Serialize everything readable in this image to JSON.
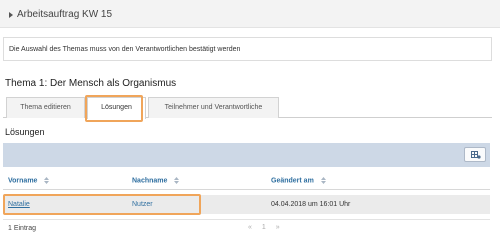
{
  "header": {
    "title": "Arbeitsauftrag KW 15"
  },
  "notice": {
    "text": "Die Auswahl des Themas muss von den Verantwortlichen bestätigt werden"
  },
  "topic": {
    "heading": "Thema 1: Der Mensch als Organismus"
  },
  "tabs": [
    {
      "label": "Thema editieren"
    },
    {
      "label": "Lösungen"
    },
    {
      "label": "Teilnehmer und Verantwortliche"
    }
  ],
  "section": {
    "title": "Lösungen"
  },
  "table": {
    "columns": [
      "Vorname",
      "Nachname",
      "Geändert am"
    ],
    "rows": [
      {
        "vorname": "Natalie",
        "nachname": "Nutzer",
        "geaendert": "04.04.2018 um 16:01 Uhr"
      }
    ],
    "footer": "1 Eintrag",
    "pager": {
      "prev": "«",
      "page": "1",
      "next": "»"
    }
  },
  "colors": {
    "accent": "#2f6fa0",
    "highlight": "#f0a55a",
    "toolbar": "#cdd8e6"
  },
  "icons": {
    "caret": "caret-right-icon",
    "columns": "column-settings-icon",
    "sort": "sort-icon"
  }
}
